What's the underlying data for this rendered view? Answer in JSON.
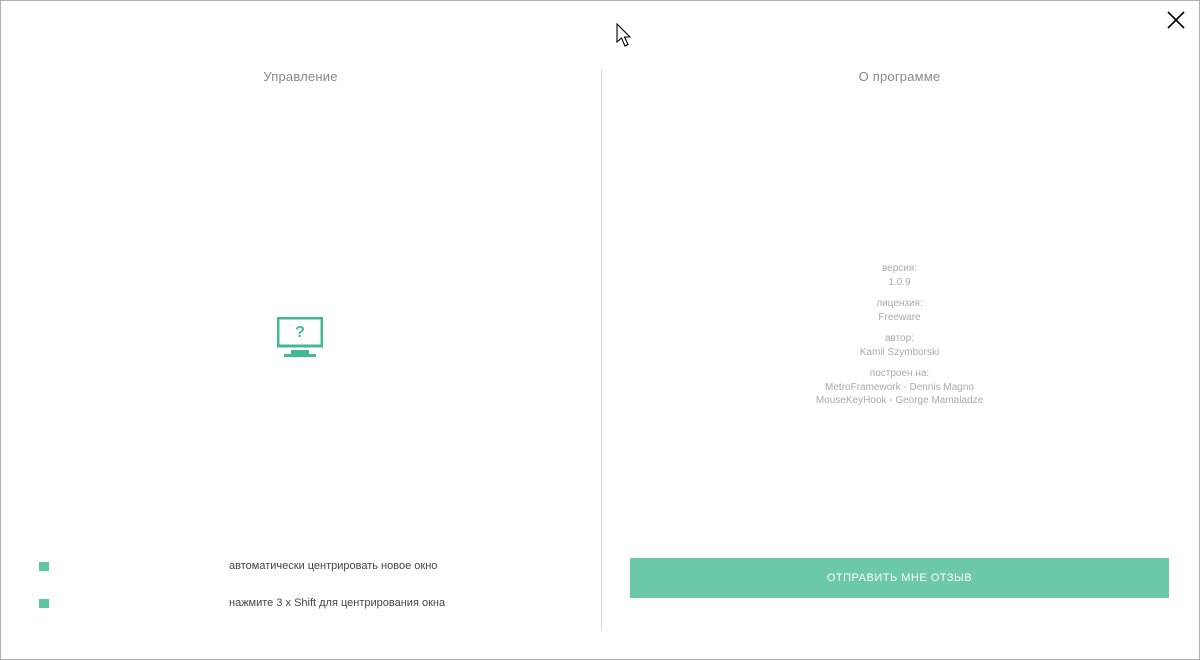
{
  "sections": {
    "left_title": "Управление",
    "right_title": "О программе"
  },
  "toggles": {
    "auto_center": "автоматически центрировать новое окно",
    "shift_center": "нажмите 3 x Shift для центрирования окна"
  },
  "monitor": {
    "symbol": "?"
  },
  "about": {
    "version_label": "версия:",
    "version_value": "1.0.9",
    "license_label": "лицензия:",
    "license_value": "Freeware",
    "author_label": "автор:",
    "author_value": "Kamil Szymborski",
    "built_on_label": "построен на:",
    "built_on_1": "MetroFramework - Dennis Magno",
    "built_on_2": "MouseKeyHook - George Mamaladze"
  },
  "buttons": {
    "feedback": "ОТПРАВИТЬ МНЕ ОТЗЫВ"
  }
}
